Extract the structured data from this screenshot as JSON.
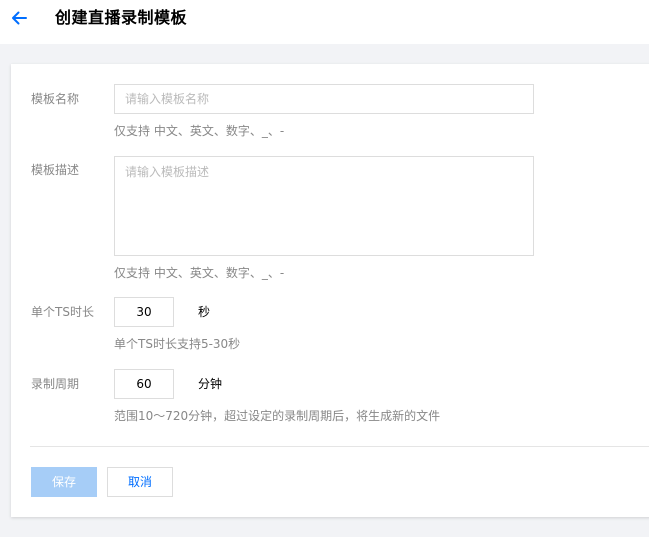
{
  "header": {
    "back_icon": "arrow-left-icon",
    "title": "创建直播录制模板"
  },
  "colors": {
    "accent": "#006eff",
    "save_disabled": "#a6cdf7",
    "label": "#888888",
    "background": "#f2f3f6"
  },
  "form": {
    "template_name": {
      "label": "模板名称",
      "placeholder": "请输入模板名称",
      "value": "",
      "hint": "仅支持 中文、英文、数字、_、-"
    },
    "template_desc": {
      "label": "模板描述",
      "placeholder": "请输入模板描述",
      "value": "",
      "hint": "仅支持 中文、英文、数字、_、-"
    },
    "ts_duration": {
      "label": "单个TS时长",
      "value": "30",
      "unit": "秒",
      "hint": "单个TS时长支持5-30秒"
    },
    "record_period": {
      "label": "录制周期",
      "value": "60",
      "unit": "分钟",
      "hint": "范围10～720分钟，超过设定的录制周期后，将生成新的文件"
    }
  },
  "actions": {
    "save_label": "保存",
    "cancel_label": "取消"
  }
}
